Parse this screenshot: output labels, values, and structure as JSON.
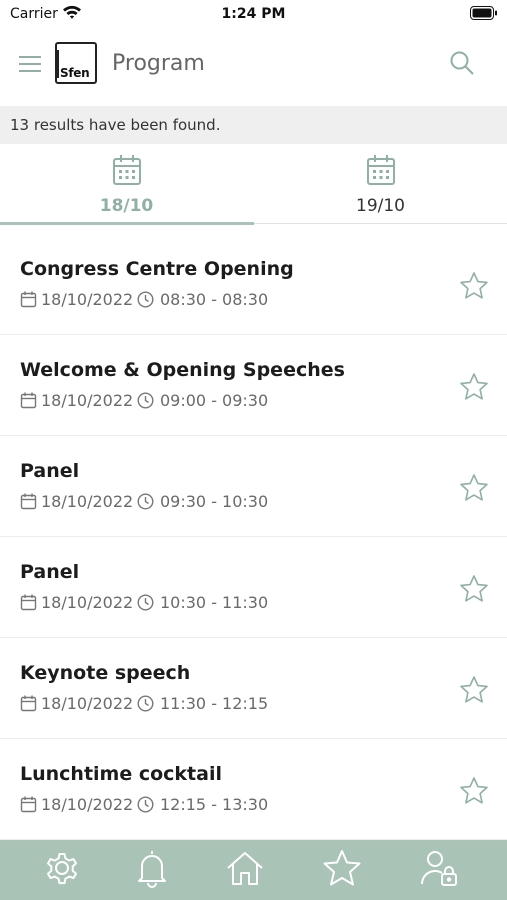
{
  "status_bar": {
    "carrier": "Carrier",
    "time": "1:24 PM"
  },
  "header": {
    "logo_text": "Sfen",
    "title": "Program"
  },
  "results": {
    "text": "13 results have been found."
  },
  "day_tabs": [
    {
      "label": "18/10",
      "selected": true
    },
    {
      "label": "19/10",
      "selected": false
    }
  ],
  "events": [
    {
      "title": "Congress Centre Opening",
      "date": "18/10/2022",
      "time": "08:30 - 08:30"
    },
    {
      "title": "Welcome & Opening Speeches",
      "date": "18/10/2022",
      "time": "09:00 - 09:30"
    },
    {
      "title": "Panel",
      "date": "18/10/2022",
      "time": "09:30 - 10:30"
    },
    {
      "title": "Panel",
      "date": "18/10/2022",
      "time": "10:30 - 11:30"
    },
    {
      "title": "Keynote speech",
      "date": "18/10/2022",
      "time": "11:30 - 12:15"
    },
    {
      "title": "Lunchtime cocktail",
      "date": "18/10/2022",
      "time": "12:15 - 13:30"
    }
  ],
  "bottom_nav": {
    "items": [
      "settings-icon",
      "notifications-icon",
      "home-icon",
      "favorites-icon",
      "account-lock-icon"
    ]
  },
  "colors": {
    "accent": "#a9c3b7",
    "accent_text": "#8fb0a2",
    "results_bg": "#efefef"
  }
}
